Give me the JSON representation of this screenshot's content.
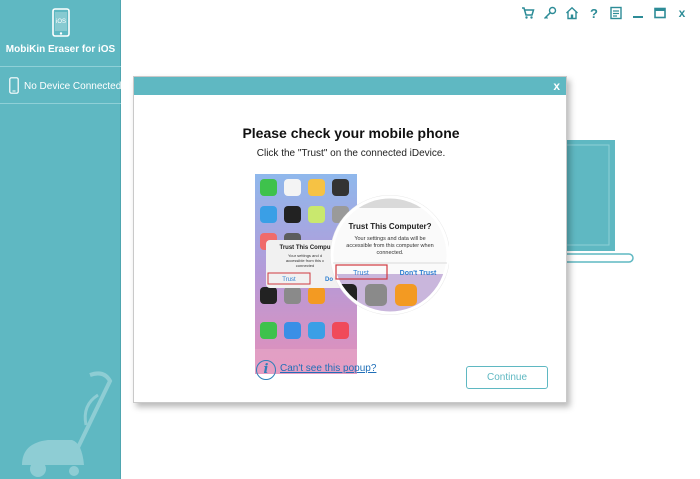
{
  "app": {
    "name": "MobiKin Eraser for iOS",
    "logo_text": "iOS"
  },
  "sidebar": {
    "device_label": "No Device Connected"
  },
  "toolbar": {
    "icons": [
      "cart-icon",
      "key-icon",
      "home-icon",
      "help-icon",
      "feedback-icon",
      "minimize-icon",
      "maximize-icon",
      "close-icon"
    ],
    "question_glyph": "?",
    "close_glyph": "x"
  },
  "dialog": {
    "close_glyph": "x",
    "title": "Please check your mobile phone",
    "subtitle": "Click the \"Trust\" on the connected iDevice.",
    "popup": {
      "title": "Trust This Computer?",
      "body_lines": [
        "Your settings and data will be",
        "accessible from this computer when",
        "connected."
      ],
      "trust_label": "Trust",
      "dont_trust_label": "Don't Trust",
      "small_title": "Trust This Compu",
      "small_body": [
        "Your settings and d",
        "accessible from this c",
        "connected"
      ],
      "small_trust": "Trust",
      "small_dont": "Do"
    },
    "help_glyph": "i",
    "help_link": "Can't see this popup?",
    "continue_label": "Continue"
  },
  "colors": {
    "accent": "#5fb8c2",
    "link": "#1f6fb8",
    "trust_highlight": "#d0393f"
  }
}
